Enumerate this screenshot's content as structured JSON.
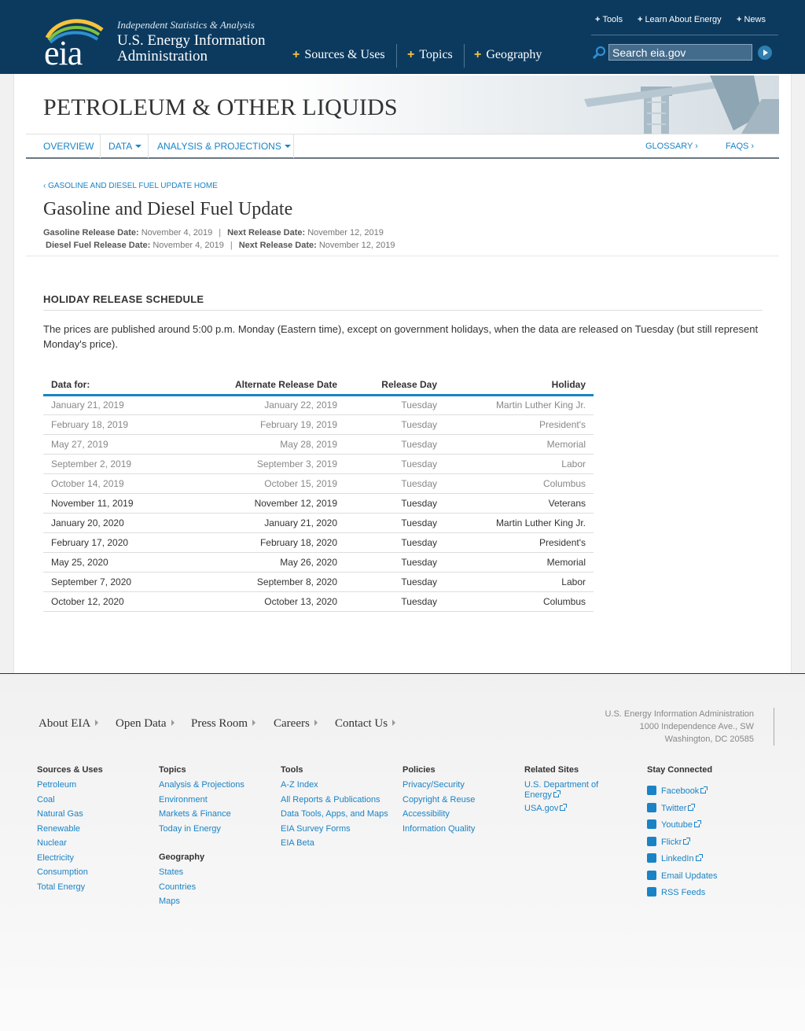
{
  "header": {
    "logo_text": "eia",
    "tagline": "Independent Statistics & Analysis",
    "org_name": "U.S. Energy Information Administration",
    "main_nav": [
      "Sources & Uses",
      "Topics",
      "Geography"
    ],
    "util_nav": [
      "Tools",
      "Learn About Energy",
      "News"
    ],
    "search_placeholder": "Search eia.gov"
  },
  "section": {
    "title": "PETROLEUM & OTHER LIQUIDS",
    "subnav": {
      "overview": "OVERVIEW",
      "data": "DATA",
      "analysis": "ANALYSIS & PROJECTIONS",
      "glossary": "GLOSSARY ›",
      "faqs": "FAQS ›"
    }
  },
  "page": {
    "breadcrumb": "‹ GASOLINE AND DIESEL FUEL UPDATE HOME",
    "title": "Gasoline and Diesel Fuel Update",
    "release": {
      "gas_label": "Gasoline Release Date:",
      "gas_date": "November 4, 2019",
      "gas_next_label": "Next Release Date:",
      "gas_next_date": "November 12, 2019",
      "diesel_label": "Diesel Fuel Release Date:",
      "diesel_date": "November 4, 2019",
      "diesel_next_label": "Next Release Date:",
      "diesel_next_date": "November 12, 2019",
      "separator": "|"
    }
  },
  "holiday": {
    "heading": "HOLIDAY RELEASE SCHEDULE",
    "intro": "The prices are published around 5:00 p.m. Monday (Eastern time), except on government holidays, when the data are released on Tuesday (but still represent Monday's price).",
    "columns": [
      "Data for:",
      "Alternate Release Date",
      "Release Day",
      "Holiday"
    ],
    "rows": [
      {
        "data_for": "January 21, 2019",
        "alt_date": "January 22, 2019",
        "day": "Tuesday",
        "holiday": "Martin Luther King Jr.",
        "past": true
      },
      {
        "data_for": "February 18, 2019",
        "alt_date": "February 19, 2019",
        "day": "Tuesday",
        "holiday": "President's",
        "past": true
      },
      {
        "data_for": "May 27, 2019",
        "alt_date": "May 28, 2019",
        "day": "Tuesday",
        "holiday": "Memorial",
        "past": true
      },
      {
        "data_for": "September 2, 2019",
        "alt_date": "September 3, 2019",
        "day": "Tuesday",
        "holiday": "Labor",
        "past": true
      },
      {
        "data_for": "October 14, 2019",
        "alt_date": "October 15, 2019",
        "day": "Tuesday",
        "holiday": "Columbus",
        "past": true
      },
      {
        "data_for": "November 11, 2019",
        "alt_date": "November 12, 2019",
        "day": "Tuesday",
        "holiday": "Veterans",
        "past": false
      },
      {
        "data_for": "January 20, 2020",
        "alt_date": "January 21, 2020",
        "day": "Tuesday",
        "holiday": "Martin Luther King Jr.",
        "past": false
      },
      {
        "data_for": "February 17, 2020",
        "alt_date": "February 18, 2020",
        "day": "Tuesday",
        "holiday": "President's",
        "past": false
      },
      {
        "data_for": "May 25, 2020",
        "alt_date": "May 26, 2020",
        "day": "Tuesday",
        "holiday": "Memorial",
        "past": false
      },
      {
        "data_for": "September 7, 2020",
        "alt_date": "September 8, 2020",
        "day": "Tuesday",
        "holiday": "Labor",
        "past": false
      },
      {
        "data_for": "October 12, 2020",
        "alt_date": "October 13, 2020",
        "day": "Tuesday",
        "holiday": "Columbus",
        "past": false
      }
    ]
  },
  "footer": {
    "nav": [
      "About EIA",
      "Open Data",
      "Press Room",
      "Careers",
      "Contact Us"
    ],
    "address": [
      "U.S. Energy Information Administration",
      "1000 Independence Ave., SW",
      "Washington, DC 20585"
    ],
    "columns": {
      "sources": {
        "heading": "Sources & Uses",
        "links": [
          "Petroleum",
          "Coal",
          "Natural Gas",
          "Renewable",
          "Nuclear",
          "Electricity",
          "Consumption",
          "Total Energy"
        ]
      },
      "topics": {
        "heading": "Topics",
        "links": [
          "Analysis & Projections",
          "Environment",
          "Markets & Finance",
          "Today in Energy"
        ]
      },
      "geography": {
        "heading": "Geography",
        "links": [
          "States",
          "Countries",
          "Maps"
        ]
      },
      "tools": {
        "heading": "Tools",
        "links": [
          "A-Z Index",
          "All Reports & Publications",
          "Data Tools, Apps, and Maps",
          "EIA Survey Forms",
          "EIA Beta"
        ]
      },
      "policies": {
        "heading": "Policies",
        "links": [
          "Privacy/Security",
          "Copyright & Reuse",
          "Accessibility",
          "Information Quality"
        ]
      },
      "related": {
        "heading": "Related Sites",
        "links": [
          "U.S. Department of Energy",
          "USA.gov"
        ]
      },
      "social": {
        "heading": "Stay Connected",
        "links": [
          "Facebook",
          "Twitter",
          "Youtube",
          "Flickr",
          "LinkedIn",
          "Email Updates",
          "RSS Feeds"
        ]
      }
    }
  },
  "colors": {
    "header_bg": "#0c3a5f",
    "link": "#1a83c5",
    "accent": "#f7c33d"
  }
}
